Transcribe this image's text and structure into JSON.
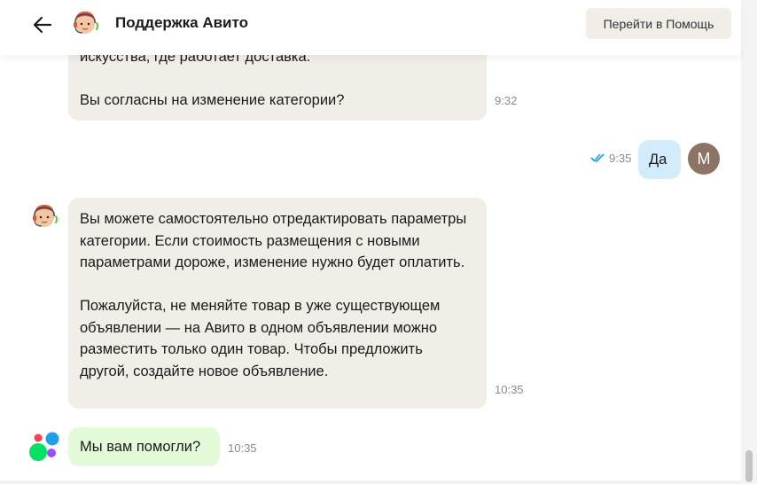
{
  "header": {
    "title": "Поддержка Авито",
    "help_button": "Перейти в Помощь"
  },
  "messages": [
    {
      "paragraphs": [
        "искусства, где работает доставка.",
        "Вы согласны на изменение категории?"
      ],
      "time": "9:32"
    },
    {
      "text": "Да",
      "time": "9:35",
      "status": "read",
      "user_initial": "M"
    },
    {
      "paragraphs": [
        "Вы можете самостоятельно отредактировать параметры категории. Если стоимость размещения с новыми параметрами дороже, изменение нужно будет оплатить.",
        "Пожалуйста, не меняйте товар в уже существующем объявлении — на Авито в одном объявлении можно разместить только один товар. Чтобы предложить другой, создайте новое объявление."
      ],
      "time": "10:35"
    },
    {
      "text": "Мы вам помогли?",
      "time": "10:35"
    }
  ],
  "colors": {
    "incoming_bubble": "#f1eee8",
    "outgoing_bubble": "#d2ecfb",
    "prompt_bubble": "#e3fbd9",
    "read_ticks": "#1fa0e6"
  }
}
